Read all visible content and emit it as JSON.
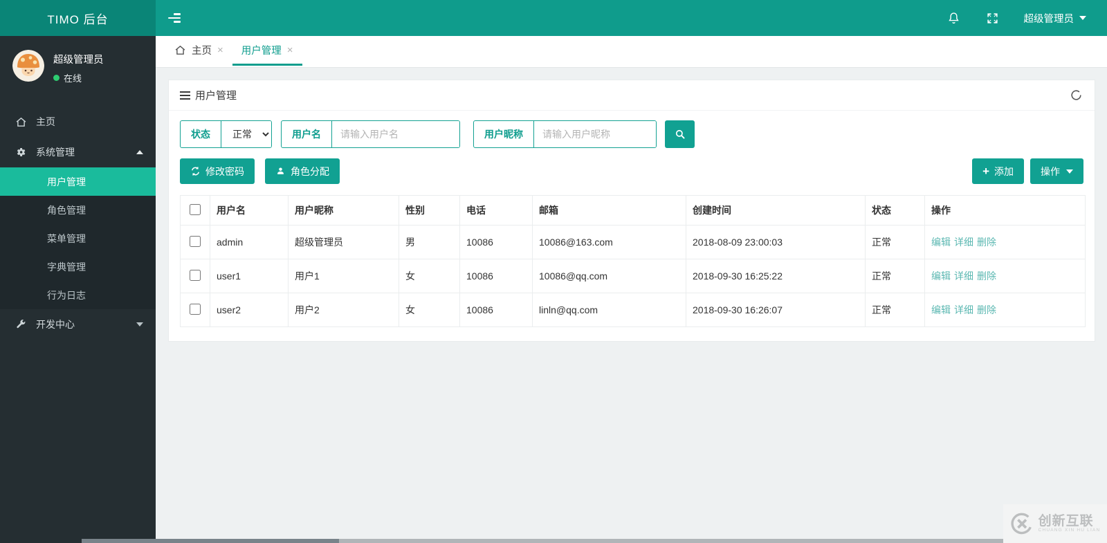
{
  "topbar": {
    "brand": "TIMO 后台",
    "user": "超级管理员"
  },
  "sidebar": {
    "user": {
      "name": "超级管理员",
      "status": "在线"
    },
    "items": [
      {
        "label": "主页"
      },
      {
        "label": "系统管理"
      },
      {
        "label": "开发中心"
      }
    ],
    "submenu": [
      "用户管理",
      "角色管理",
      "菜单管理",
      "字典管理",
      "行为日志"
    ]
  },
  "tabs": [
    {
      "label": "主页"
    },
    {
      "label": "用户管理"
    }
  ],
  "panel": {
    "title": "用户管理",
    "filters": {
      "status_label": "状态",
      "status_value": "正常",
      "username_label": "用户名",
      "username_placeholder": "请输入用户名",
      "nickname_label": "用户昵称",
      "nickname_placeholder": "请输入用户昵称"
    },
    "toolbar": {
      "change_password": "修改密码",
      "assign_role": "角色分配",
      "add": "添加",
      "operate": "操作"
    }
  },
  "table": {
    "headers": [
      "用户名",
      "用户昵称",
      "性别",
      "电话",
      "邮箱",
      "创建时间",
      "状态",
      "操作"
    ],
    "rows": [
      {
        "username": "admin",
        "nickname": "超级管理员",
        "gender": "男",
        "phone": "10086",
        "email": "10086@163.com",
        "created": "2018-08-09 23:00:03",
        "status": "正常"
      },
      {
        "username": "user1",
        "nickname": "用户1",
        "gender": "女",
        "phone": "10086",
        "email": "10086@qq.com",
        "created": "2018-09-30 16:25:22",
        "status": "正常"
      },
      {
        "username": "user2",
        "nickname": "用户2",
        "gender": "女",
        "phone": "10086",
        "email": "linln@qq.com",
        "created": "2018-09-30 16:26:07",
        "status": "正常"
      }
    ],
    "actions": [
      "编辑",
      "详细",
      "删除"
    ]
  },
  "watermark": {
    "title": "创新互联",
    "subtitle": "CHUANG XIN HU LIAN"
  },
  "ui": {
    "close": "×"
  },
  "colors": {
    "topbar": "#0f9c8c",
    "brand_bg": "#0a8577",
    "sidebar": "#252e32",
    "accent": "#0f9d8e",
    "active_item": "#1abb9c",
    "link": "#5cb8b2"
  }
}
